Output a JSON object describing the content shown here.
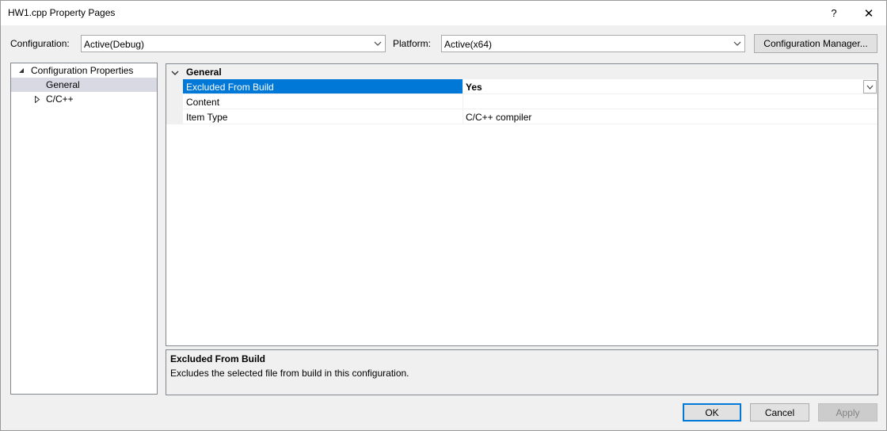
{
  "window": {
    "title": "HW1.cpp Property Pages",
    "help_glyph": "?",
    "close_glyph": "✕"
  },
  "toolbar": {
    "configuration_label": "Configuration:",
    "configuration_value": "Active(Debug)",
    "platform_label": "Platform:",
    "platform_value": "Active(x64)",
    "config_manager_label": "Configuration Manager..."
  },
  "tree": {
    "items": [
      {
        "label": "Configuration Properties",
        "expander": "◢",
        "level": 0,
        "selected": false
      },
      {
        "label": "General",
        "expander": "",
        "level": 1,
        "selected": true
      },
      {
        "label": "C/C++",
        "expander": "▷",
        "level": 1,
        "selected": false
      }
    ]
  },
  "grid": {
    "category": "General",
    "rows": [
      {
        "name": "Excluded From Build",
        "value": "Yes",
        "selected": true,
        "bold_value": true
      },
      {
        "name": "Content",
        "value": "",
        "selected": false,
        "bold_value": false
      },
      {
        "name": "Item Type",
        "value": "C/C++ compiler",
        "selected": false,
        "bold_value": false
      }
    ]
  },
  "description": {
    "title": "Excluded From Build",
    "text": "Excludes the selected file from build in this configuration."
  },
  "footer": {
    "ok_label": "OK",
    "cancel_label": "Cancel",
    "apply_label": "Apply"
  },
  "colors": {
    "selection_blue": "#0078d7",
    "tree_selected": "#d9d9e4",
    "dialog_bg": "#f0f0f0"
  }
}
